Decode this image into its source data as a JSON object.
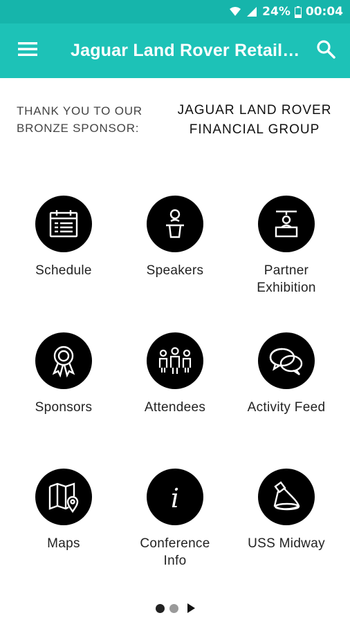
{
  "status_bar": {
    "battery": "24%",
    "time": "00:04",
    "icons": [
      "wifi-icon",
      "signal-icon",
      "battery-icon"
    ]
  },
  "app_bar": {
    "title": "Jaguar Land Rover Retailer Conference",
    "menu_icon": "hamburger-menu-icon",
    "search_icon": "search-icon",
    "color": "#1dc2b7"
  },
  "sponsor": {
    "lead": "THANK YOU TO OUR\nBRONZE SPONSOR:",
    "name": "JAGUAR LAND ROVER\nFINANCIAL GROUP"
  },
  "tiles": [
    {
      "label": "Schedule",
      "icon": "calendar-icon"
    },
    {
      "label": "Speakers",
      "icon": "speaker-podium-icon"
    },
    {
      "label": "Partner\nExhibition",
      "icon": "exhibition-booth-icon"
    },
    {
      "label": "Sponsors",
      "icon": "award-ribbon-icon"
    },
    {
      "label": "Attendees",
      "icon": "people-group-icon"
    },
    {
      "label": "Activity Feed",
      "icon": "chat-bubbles-icon"
    },
    {
      "label": "Maps",
      "icon": "map-pin-icon"
    },
    {
      "label": "Conference\nInfo",
      "icon": "info-icon"
    },
    {
      "label": "USS Midway",
      "icon": "spotlight-icon"
    }
  ],
  "pager": {
    "pages": 2,
    "current": 1
  }
}
